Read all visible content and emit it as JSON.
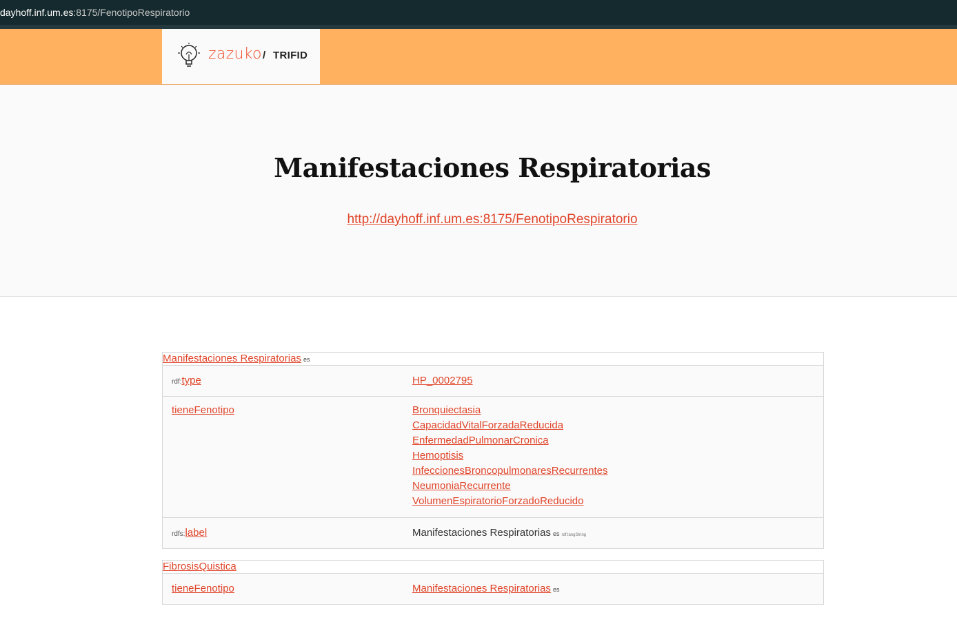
{
  "browser": {
    "url_host": "dayhoff.inf.um.es",
    "url_path": ":8175/FenotipoRespiratorio"
  },
  "header": {
    "logo_text": "zazuko",
    "separator": "/",
    "product": "TRIFID",
    "colors": {
      "header_bg": "#ffb160",
      "accent": "#e0452a"
    }
  },
  "hero": {
    "title": "Manifestaciones Respiratorias",
    "iri": "http://dayhoff.inf.um.es:8175/FenotipoRespiratorio"
  },
  "subjects": [
    {
      "title": "Manifestaciones Respiratorias",
      "lang": "es",
      "rows": [
        {
          "prefix": "rdf:",
          "predicate": "type",
          "objects": [
            "HP_0002795"
          ]
        },
        {
          "prefix": "",
          "predicate": "tieneFenotipo",
          "objects": [
            "Bronquiectasia",
            "CapacidadVitalForzadaReducida",
            "EnfermedadPulmonarCronica",
            "Hemoptisis",
            "InfeccionesBroncopulmonaresRecurrentes",
            "NeumoniaRecurrente",
            "VolumenEspiratorioForzadoReducido"
          ]
        },
        {
          "prefix": "rdfs:",
          "predicate": "label",
          "literal": "Manifestaciones Respiratorias",
          "literal_lang": "es",
          "literal_type": "rdf:langString"
        }
      ]
    },
    {
      "title": "FibrosisQuistica",
      "rows": [
        {
          "prefix": "",
          "predicate": "tieneFenotipo",
          "object_link": "Manifestaciones Respiratorias",
          "object_lang": "es"
        }
      ]
    }
  ]
}
